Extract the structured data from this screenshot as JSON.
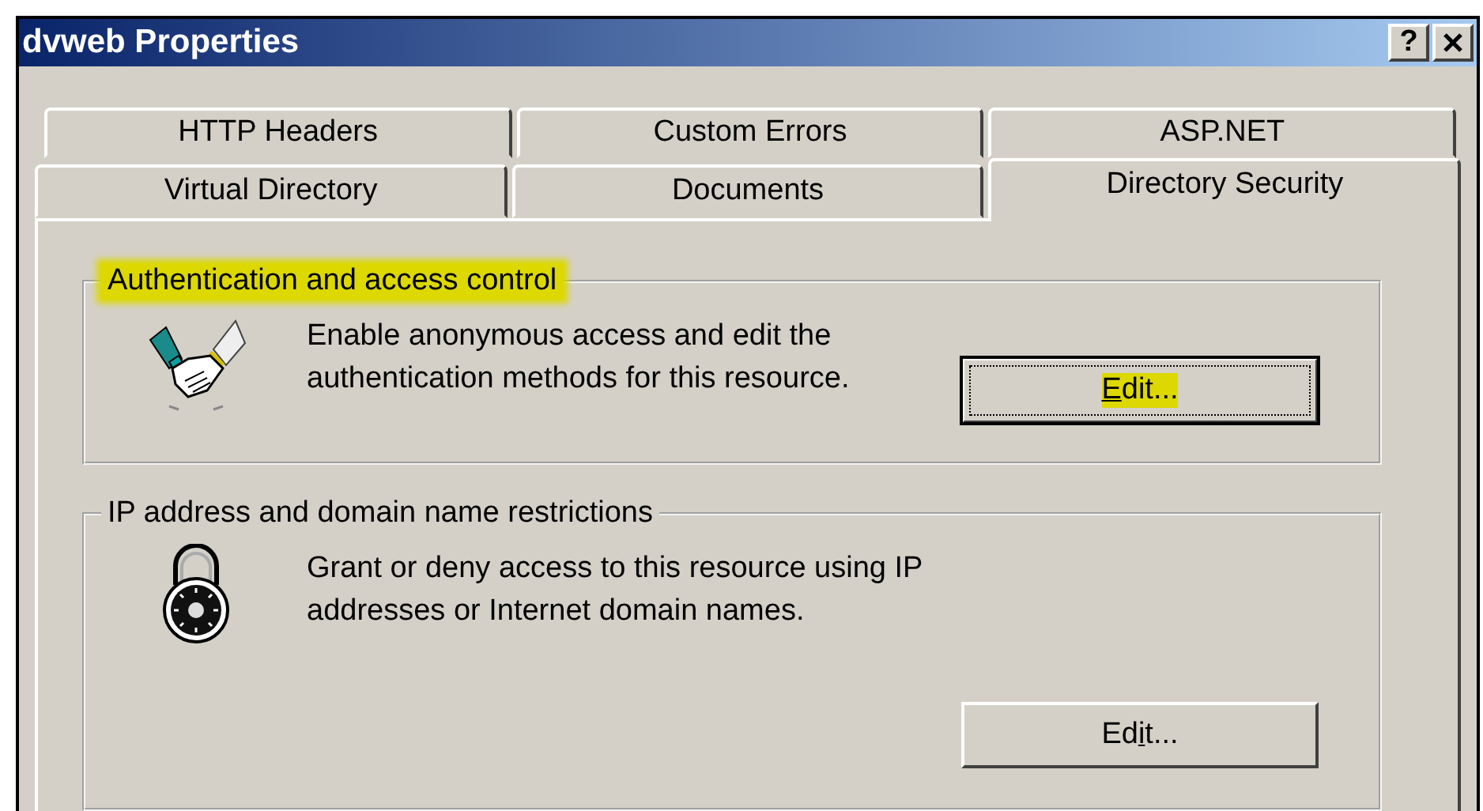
{
  "window": {
    "title": "dvweb Properties",
    "help_button": "?"
  },
  "tab_rows": [
    [
      {
        "label": "HTTP Headers",
        "selected": false
      },
      {
        "label": "Custom Errors",
        "selected": false
      },
      {
        "label": "ASP.NET",
        "selected": false
      }
    ],
    [
      {
        "label": "Virtual Directory",
        "selected": false
      },
      {
        "label": "Documents",
        "selected": false
      },
      {
        "label": "Directory Security",
        "selected": true
      }
    ]
  ],
  "groups": [
    {
      "title": "Authentication and access control",
      "title_highlighted": true,
      "description": "Enable anonymous access and edit the authentication methods for this resource.",
      "button": {
        "label_parts": [
          {
            "text": "E",
            "underline": true
          },
          {
            "text": "dit...",
            "underline": false
          }
        ],
        "focused": true,
        "highlighted": true
      }
    },
    {
      "title": "IP address and domain name restrictions",
      "title_highlighted": false,
      "description": "Grant or deny access to this resource using IP addresses or Internet domain names.",
      "button": {
        "label_parts": [
          {
            "text": "Ed",
            "underline": false
          },
          {
            "text": "i",
            "underline": true
          },
          {
            "text": "t...",
            "underline": false
          }
        ],
        "focused": false,
        "highlighted": false
      }
    }
  ]
}
